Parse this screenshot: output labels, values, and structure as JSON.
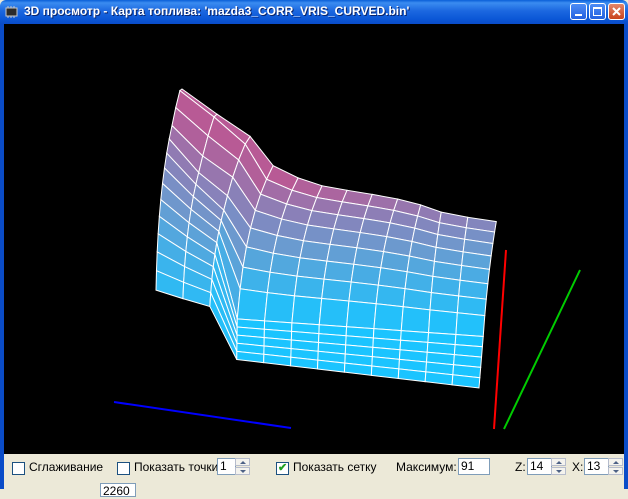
{
  "window": {
    "title": "3D просмотр - Карта топлива: 'mazda3_CORR_VRIS_CURVED.bin'"
  },
  "colors": {
    "surface_low": "#1BC4FF",
    "surface_mid": "#6A9BD0",
    "surface_high": "#B85A95",
    "axis_x": "#FF0000",
    "axis_y": "#00CC00",
    "axis_z": "#0000FF",
    "viewport_bg": "#000000"
  },
  "controls": {
    "smoothing": {
      "label": "Сглаживание",
      "checked": false
    },
    "show_points": {
      "label": "Показать точки",
      "checked": false,
      "value": "1"
    },
    "show_grid": {
      "label": "Показать сетку",
      "checked": true
    },
    "maximum": {
      "label": "Максимум:",
      "value": "91"
    },
    "z": {
      "label": "Z:",
      "value": "14"
    },
    "x": {
      "label": "X:",
      "value": "13"
    },
    "cutoff_value": "2260"
  }
}
